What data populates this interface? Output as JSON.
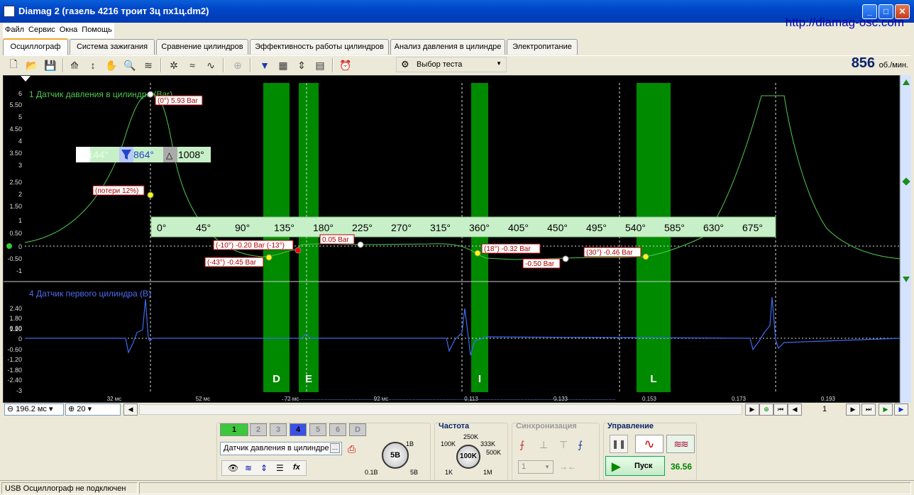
{
  "window": {
    "title": "Diamag 2 (газель 4216 троит 3ц пх1ц.dm2)",
    "min": "_",
    "max": "□",
    "close": "✕"
  },
  "url": "http://diamag-osc.com",
  "menu": [
    "Файл",
    "Сервис",
    "Окна",
    "Помощь"
  ],
  "tabs": [
    "Осциллограф",
    "Система зажигания",
    "Сравнение цилиндров",
    "Эффективность работы цилиндров",
    "Анализ давления в цилиндре",
    "Электропитание"
  ],
  "toolbar": {
    "test_select": "Выбор теста",
    "rpm_value": "856",
    "rpm_unit": "об./мин."
  },
  "channel1": {
    "label": "1 Датчик давления в цилиндре (Bar)",
    "y_ticks": [
      "6",
      "5.50",
      "5",
      "4.50",
      "4",
      "3.50",
      "3",
      "2.50",
      "2",
      "1.50",
      "1",
      "0.50",
      "0",
      "-0.50",
      "-1"
    ],
    "angles": [
      "0°",
      "45°",
      "90°",
      "135°",
      "180°",
      "225°",
      "270°",
      "315°",
      "360°",
      "405°",
      "450°",
      "495°",
      "540°",
      "585°",
      "630°",
      "675°"
    ],
    "cursor_box": {
      "a": "-144°",
      "b": "864°",
      "c": "1008°"
    },
    "markers": [
      "(0°) 5.93 Bar",
      "(потери 12%)",
      "(-10°) -0.20 Bar (-13°)",
      "0.05 Bar",
      "(-43°) -0.45 Bar",
      "(18°) -0.32 Bar",
      "-0.50 Bar",
      "(30°) -0.46 Bar"
    ],
    "zones": [
      "D",
      "E",
      "I",
      "L"
    ]
  },
  "channel4": {
    "label": "4 Датчик первого цилиндра (B)",
    "y_ticks": [
      "2.40",
      "1.80",
      "1.20",
      "0.60",
      "0",
      "-0.60",
      "-1.20",
      "-1.80",
      "-2.40",
      "-3"
    ]
  },
  "time_ticks": [
    "32 мс",
    "52 мс",
    "72 мс",
    "92 мс",
    "0.113",
    "0.133",
    "0.153",
    "0.173",
    "0.193"
  ],
  "bottom": {
    "timebase": "196.2 мс",
    "zoom": "20",
    "page": "1"
  },
  "channels": [
    "1",
    "2",
    "3",
    "4",
    "5",
    "6",
    "D"
  ],
  "sensor_select": "Датчик давления в цилиндре",
  "volt_knob": {
    "center": "5В",
    "min": "0.1В",
    "mid": "1В",
    "max": "5В"
  },
  "freq": {
    "title": "Частота",
    "center": "100K",
    "labels": [
      "250K",
      "333K",
      "500K",
      "100K",
      "1K",
      "1M"
    ]
  },
  "sync": {
    "title": "Синхронизация",
    "value": "1"
  },
  "control": {
    "title": "Управление",
    "start": "Пуск",
    "value": "36.56"
  },
  "status": {
    "usb": "USB Осциллограф не подключен"
  },
  "colors": {
    "pressure": "#4EC94E",
    "sensor": "#3C6CF0",
    "zone": "#008A00",
    "marker_box": "#B00000"
  }
}
